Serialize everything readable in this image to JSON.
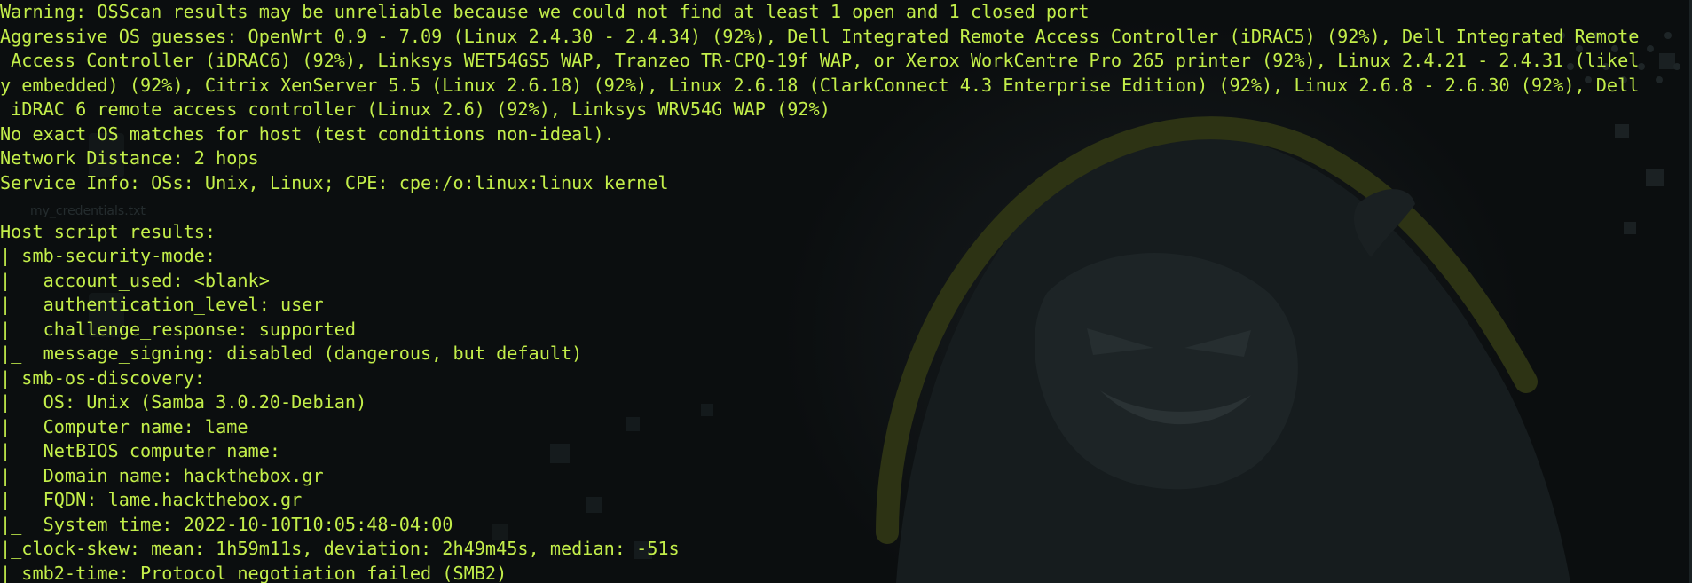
{
  "terminal": {
    "lines": [
      "Warning: OSScan results may be unreliable because we could not find at least 1 open and 1 closed port",
      "Aggressive OS guesses: OpenWrt 0.9 - 7.09 (Linux 2.4.30 - 2.4.34) (92%), Dell Integrated Remote Access Controller (iDRAC5) (92%), Dell Integrated Remote",
      " Access Controller (iDRAC6) (92%), Linksys WET54GS5 WAP, Tranzeo TR-CPQ-19f WAP, or Xerox WorkCentre Pro 265 printer (92%), Linux 2.4.21 - 2.4.31 (likel",
      "y embedded) (92%), Citrix XenServer 5.5 (Linux 2.6.18) (92%), Linux 2.6.18 (ClarkConnect 4.3 Enterprise Edition) (92%), Linux 2.6.8 - 2.6.30 (92%), Dell",
      " iDRAC 6 remote access controller (Linux 2.6) (92%), Linksys WRV54G WAP (92%)",
      "No exact OS matches for host (test conditions non-ideal).",
      "Network Distance: 2 hops",
      "Service Info: OSs: Unix, Linux; CPE: cpe:/o:linux:linux_kernel",
      "",
      "Host script results:",
      "| smb-security-mode:",
      "|   account_used: <blank>",
      "|   authentication_level: user",
      "|   challenge_response: supported",
      "|_  message_signing: disabled (dangerous, but default)",
      "| smb-os-discovery:",
      "|   OS: Unix (Samba 3.0.20-Debian)",
      "|   Computer name: lame",
      "|   NetBIOS computer name: ",
      "|   Domain name: hackthebox.gr",
      "|   FQDN: lame.hackthebox.gr",
      "|_  System time: 2022-10-10T10:05:48-04:00",
      "|_clock-skew: mean: 1h59m11s, deviation: 2h49m45s, median: -51s",
      "|_smb2-time: Protocol negotiation failed (SMB2)"
    ],
    "colors": {
      "text": "#c3ee4a",
      "background": "#0b0e0f"
    }
  },
  "background": {
    "desktop_ghost_label": "my_credentials.txt",
    "art_icon": "hacker-hood-icon"
  }
}
